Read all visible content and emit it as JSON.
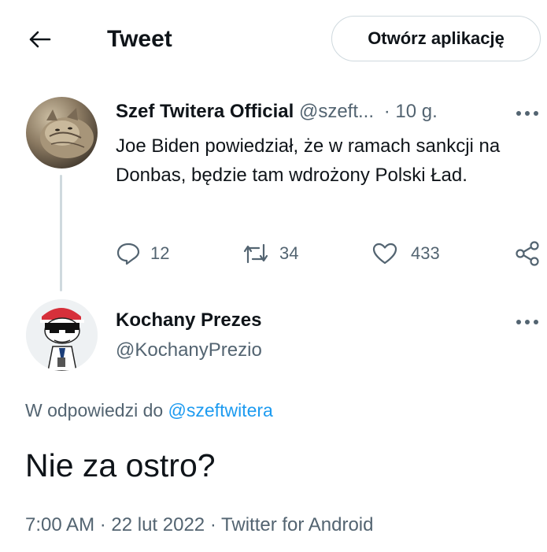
{
  "header": {
    "back_icon": "arrow-left-icon",
    "title": "Tweet",
    "open_app_label": "Otwórz aplikację"
  },
  "parent_tweet": {
    "display_name": "Szef Twitera Official",
    "handle": "@szeft...",
    "separator": "·",
    "time": "10 g.",
    "more_icon": "more-horizontal-icon",
    "text": "Joe Biden powiedział, że w ramach sankcji na Donbas, będzie tam wdrożony Polski Ład.",
    "actions": {
      "reply_count": "12",
      "retweet_count": "34",
      "like_count": "433"
    }
  },
  "main_tweet": {
    "display_name": "Kochany Prezes",
    "handle": "@KochanyPrezio",
    "more_icon": "more-horizontal-icon",
    "reply_prefix": "W odpowiedzi do",
    "reply_handle": "@szeftwitera",
    "text": "Nie za ostro?",
    "meta": "7:00 AM · 22 lut 2022 · Twitter for Android"
  },
  "colors": {
    "accent": "#1d9bf0",
    "muted": "#536471",
    "text": "#0f1419",
    "divider": "#cfd9de"
  }
}
